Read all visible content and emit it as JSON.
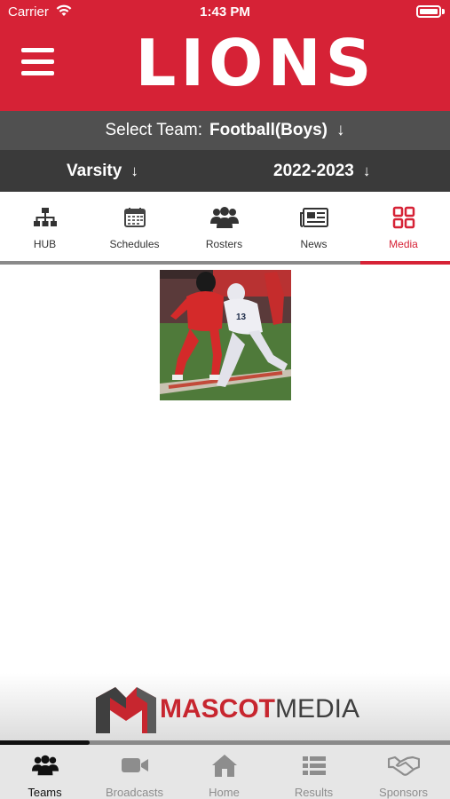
{
  "status_bar": {
    "carrier": "Carrier",
    "time": "1:43 PM",
    "icons": [
      "wifi-icon",
      "battery-icon"
    ]
  },
  "header": {
    "title": "LIONS",
    "menu_icon": "hamburger-menu-icon",
    "color": "#d62236"
  },
  "team_select": {
    "label": "Select Team:",
    "value": "Football(Boys)",
    "arrow": "↓"
  },
  "filters": {
    "level": {
      "value": "Varsity",
      "arrow": "↓"
    },
    "season": {
      "value": "2022-2023",
      "arrow": "↓"
    }
  },
  "tabs": [
    {
      "label": "HUB",
      "icon": "org-chart-icon"
    },
    {
      "label": "Schedules",
      "icon": "calendar-icon"
    },
    {
      "label": "Rosters",
      "icon": "group-icon"
    },
    {
      "label": "News",
      "icon": "newspaper-icon"
    },
    {
      "label": "Media",
      "icon": "grid-icon",
      "active": true
    }
  ],
  "media": {
    "items": [
      {
        "type": "photo",
        "icon": "football-photo"
      }
    ]
  },
  "sponsor": {
    "brand_a": "MASCOT",
    "brand_b": "MEDIA"
  },
  "bottom_nav": [
    {
      "label": "Teams",
      "icon": "group-icon",
      "active": true
    },
    {
      "label": "Broadcasts",
      "icon": "video-camera-icon"
    },
    {
      "label": "Home",
      "icon": "home-icon"
    },
    {
      "label": "Results",
      "icon": "list-icon"
    },
    {
      "label": "Sponsors",
      "icon": "handshake-icon"
    }
  ],
  "colors": {
    "accent": "#d62236",
    "dark_bar": "#3a3a3a",
    "mid_bar": "#505050",
    "inactive": "#8d8d8d"
  }
}
